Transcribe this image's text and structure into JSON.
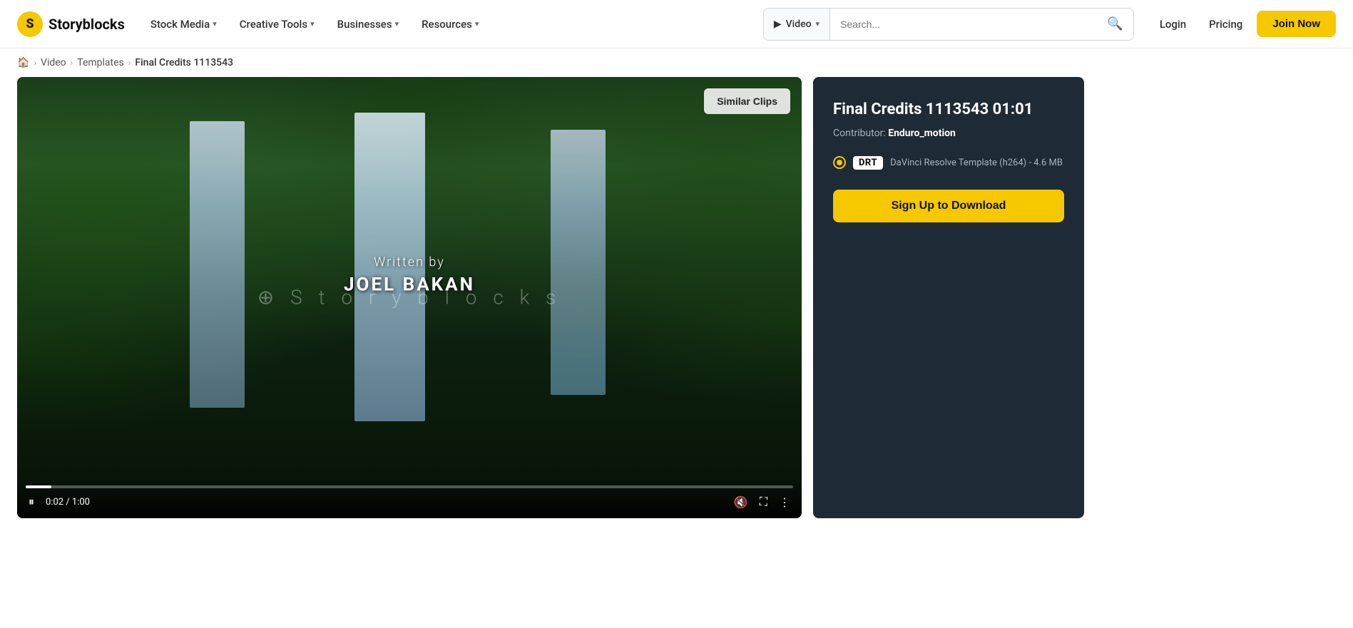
{
  "brand": {
    "logo_letter": "S",
    "name": "Storyblocks"
  },
  "navbar": {
    "stock_media": "Stock Media",
    "creative_tools": "Creative Tools",
    "businesses": "Businesses",
    "resources": "Resources",
    "search_type": "Video",
    "search_placeholder": "Search...",
    "login": "Login",
    "pricing": "Pricing",
    "join_now": "Join Now"
  },
  "breadcrumb": {
    "home": "🏠",
    "video": "Video",
    "templates": "Templates",
    "current": "Final Credits 1113543"
  },
  "video": {
    "watermark": "⊕  S t o r y b l o c k s",
    "written_by": "Written by",
    "author_name": "JOEL BAKAN",
    "similar_clips": "Similar Clips",
    "time_current": "0:02",
    "time_total": "1:00",
    "progress_percent": 3.3
  },
  "sidebar": {
    "title": "Final Credits 1113543 01:01",
    "contributor_label": "Contributor:",
    "contributor_name": "Enduro_motion",
    "format_badge": "DRT",
    "format_description": "DaVinci Resolve Template (h264) - 4.6 MB",
    "download_button": "Sign Up to Download"
  }
}
